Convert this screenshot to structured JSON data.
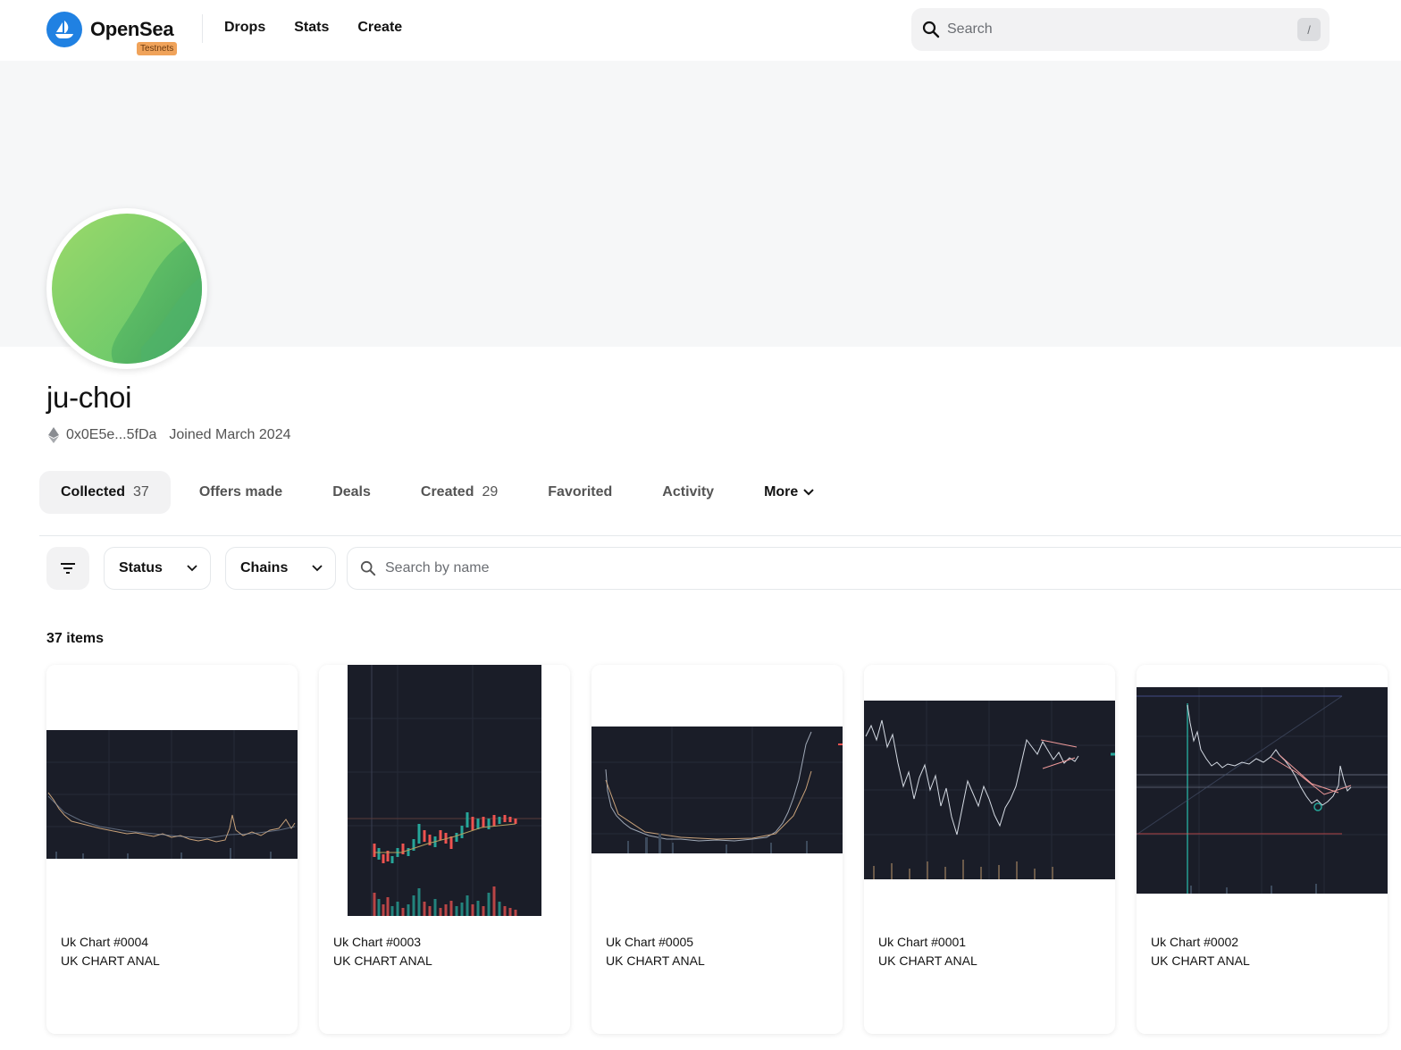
{
  "brand": {
    "name": "OpenSea",
    "badge": "Testnets",
    "accent": "#2081e2",
    "badge_color": "#f0a35a"
  },
  "nav": {
    "items": [
      "Drops",
      "Stats",
      "Create"
    ]
  },
  "search": {
    "placeholder": "Search",
    "shortcut": "/"
  },
  "profile": {
    "username": "ju-choi",
    "address": "0x0E5e...5fDa",
    "joined": "Joined March 2024",
    "chain_icon": "ethereum-icon"
  },
  "tabs": [
    {
      "label": "Collected",
      "count": "37",
      "active": true
    },
    {
      "label": "Offers made",
      "count": ""
    },
    {
      "label": "Deals",
      "count": ""
    },
    {
      "label": "Created",
      "count": "29"
    },
    {
      "label": "Favorited",
      "count": ""
    },
    {
      "label": "Activity",
      "count": ""
    },
    {
      "label": "More",
      "count": ""
    }
  ],
  "filters": {
    "status_label": "Status",
    "chains_label": "Chains",
    "name_search_placeholder": "Search by name"
  },
  "items_count": "37 items",
  "cards": [
    {
      "name": "Uk Chart #0004",
      "collection": "UK CHART ANAL"
    },
    {
      "name": "Uk Chart #0003",
      "collection": "UK CHART ANAL"
    },
    {
      "name": "Uk Chart #0005",
      "collection": "UK CHART ANAL"
    },
    {
      "name": "Uk Chart #0001",
      "collection": "UK CHART ANAL"
    },
    {
      "name": "Uk Chart #0002",
      "collection": "UK CHART ANAL"
    }
  ],
  "colors": {
    "chart_bg": "#1a1d28",
    "up": "#26a69a",
    "down": "#ef5350"
  }
}
